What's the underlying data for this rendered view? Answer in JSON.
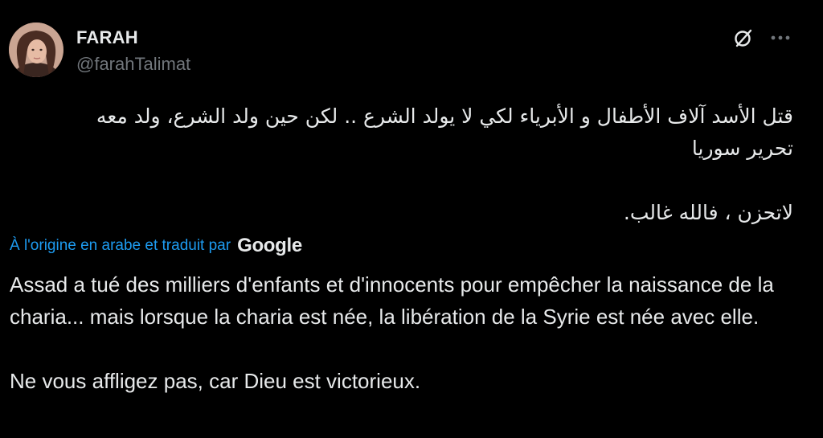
{
  "author": {
    "name": "FARAH",
    "handle": "@farahTalimat"
  },
  "icons": {
    "grok": "grok-slash-circle-icon",
    "more": "more-horizontal-icon"
  },
  "tweet": {
    "arabic_line1": "قتل الأسد آلاف الأطفال و الأبرياء لكي لا يولد الشرع .. لكن حين ولد الشرع، ولد معه",
    "arabic_line2": "تحرير سوريا",
    "arabic_line3": "لاتحزن ، فالله غالب."
  },
  "translation": {
    "link_text": "À l'origine en arabe et traduit par",
    "provider": "Google",
    "paragraph1": "Assad a tué des milliers d'enfants et d'innocents pour empêcher la naissance de la charia... mais lorsque la charia est née, la libération de la Syrie est née avec elle.",
    "paragraph2": "Ne vous affligez pas, car Dieu est victorieux."
  },
  "colors": {
    "background": "#000000",
    "text": "#e7e9ea",
    "muted": "#71767b",
    "link": "#1d9bf0"
  }
}
